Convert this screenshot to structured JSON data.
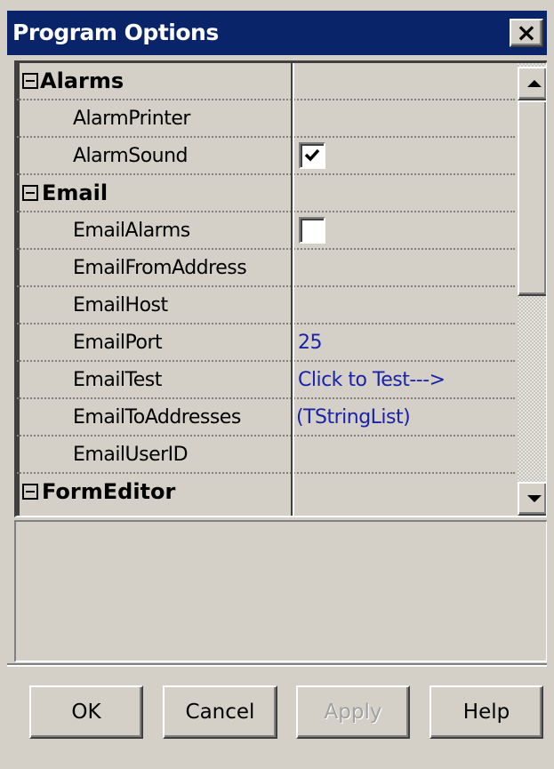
{
  "window": {
    "title": "Program Options",
    "close_glyph": "×"
  },
  "grid": {
    "categories": {
      "alarms": {
        "label": "Alarms",
        "expanded": true
      },
      "email": {
        "label": "Email",
        "expanded": true
      },
      "formeditor": {
        "label": "FormEditor",
        "expanded": true
      }
    },
    "properties": {
      "alarm_printer": {
        "label": "AlarmPrinter",
        "value": ""
      },
      "alarm_sound": {
        "label": "AlarmSound",
        "checked": true
      },
      "email_alarms": {
        "label": "EmailAlarms",
        "checked": false
      },
      "email_from_address": {
        "label": "EmailFromAddress",
        "value": ""
      },
      "email_host": {
        "label": "EmailHost",
        "value": ""
      },
      "email_port": {
        "label": "EmailPort",
        "value": "25"
      },
      "email_test": {
        "label": "EmailTest",
        "value": "Click to Test--->"
      },
      "email_to_addresses": {
        "label": "EmailToAddresses",
        "value": "(TStringList)"
      },
      "email_user_id": {
        "label": "EmailUserID",
        "value": ""
      }
    },
    "scroll_up_icon": "scroll-up-arrow-icon",
    "scroll_down_icon": "scroll-down-arrow-icon"
  },
  "buttons": {
    "ok": "OK",
    "cancel": "Cancel",
    "apply": "Apply",
    "help": "Help"
  },
  "colors": {
    "title_bar": "#0a246a",
    "value_text": "#1a22a8",
    "face": "#d4d0c8"
  }
}
